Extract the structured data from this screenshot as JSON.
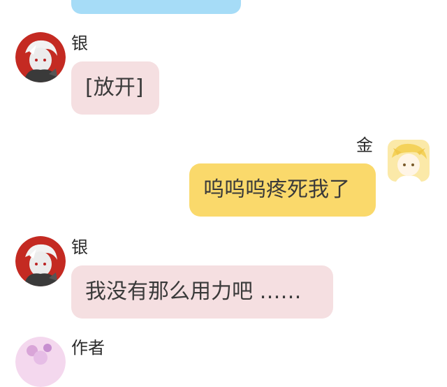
{
  "messages": [
    {
      "sender": "银",
      "text": "[放开]",
      "side": "left",
      "bubble_color": "#f5dfe1"
    },
    {
      "sender": "金",
      "text": "呜呜呜疼死我了",
      "side": "right",
      "bubble_color": "#fad96b"
    },
    {
      "sender": "银",
      "text": "我没有那么用力吧 ……",
      "side": "left",
      "bubble_color": "#f5dfe1"
    },
    {
      "sender": "作者",
      "text": "",
      "side": "left"
    }
  ],
  "top_bubble_color": "#a6dcf7",
  "avatars": {
    "silver": "silver-hair-character-avatar-icon",
    "gold": "blonde-character-avatar-icon",
    "author": "author-avatar-icon"
  }
}
